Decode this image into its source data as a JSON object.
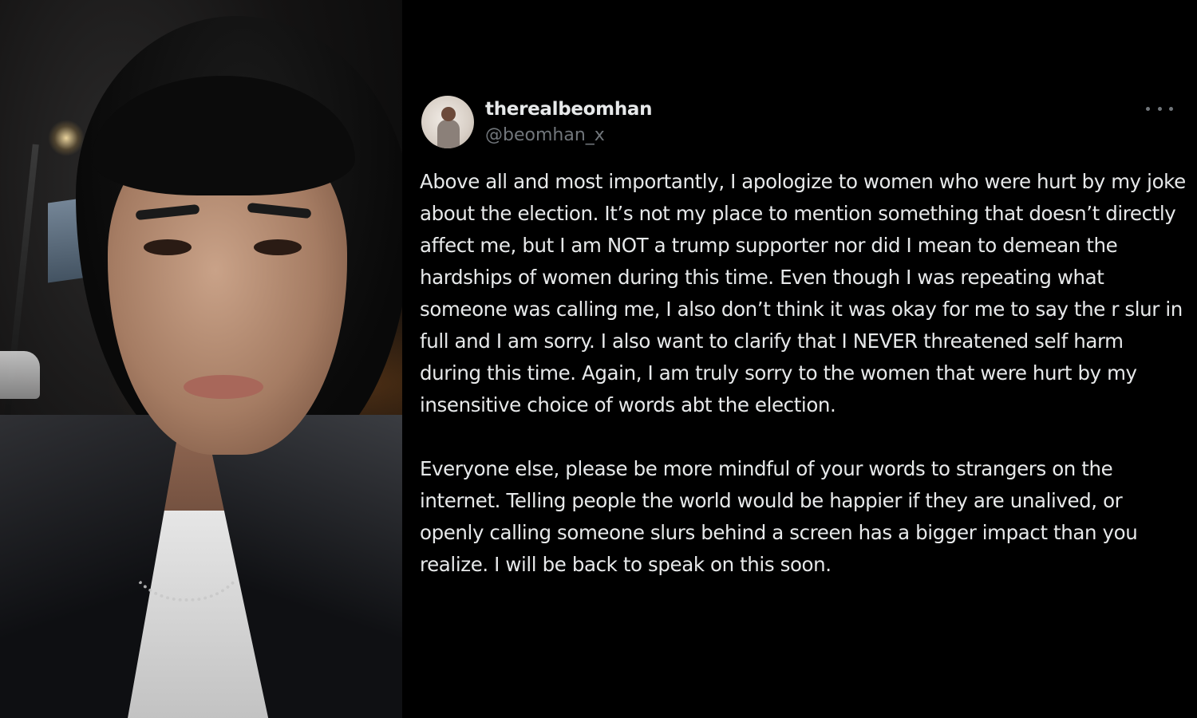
{
  "photo": {
    "description_icon": "person-photo"
  },
  "tweet": {
    "display_name": "therealbeomhan",
    "handle": "@beomhan_x",
    "more_icon": "more-dots-icon",
    "paragraphs": [
      "Above all and most importantly, I apologize to women who were hurt by my joke about the election. It’s not my place to mention something that doesn’t directly affect me, but I am NOT a trump supporter nor did I mean to demean the hardships of women during this time. Even though I was repeating what someone was calling me, I also don’t think it was okay for me to say the r slur in full and I am sorry. I also want to clarify that I NEVER threatened self harm during this time. Again, I am truly sorry to the women that were hurt by my insensitive choice of words abt the election.",
      "Everyone else, please be more mindful of your words to strangers on the internet. Telling people the world would be happier if they are unalived, or openly calling someone slurs behind a screen has a bigger impact than you realize. I will be back to speak on this soon."
    ]
  },
  "colors": {
    "background": "#000000",
    "text": "#e7e9ea",
    "muted": "#71767b"
  }
}
